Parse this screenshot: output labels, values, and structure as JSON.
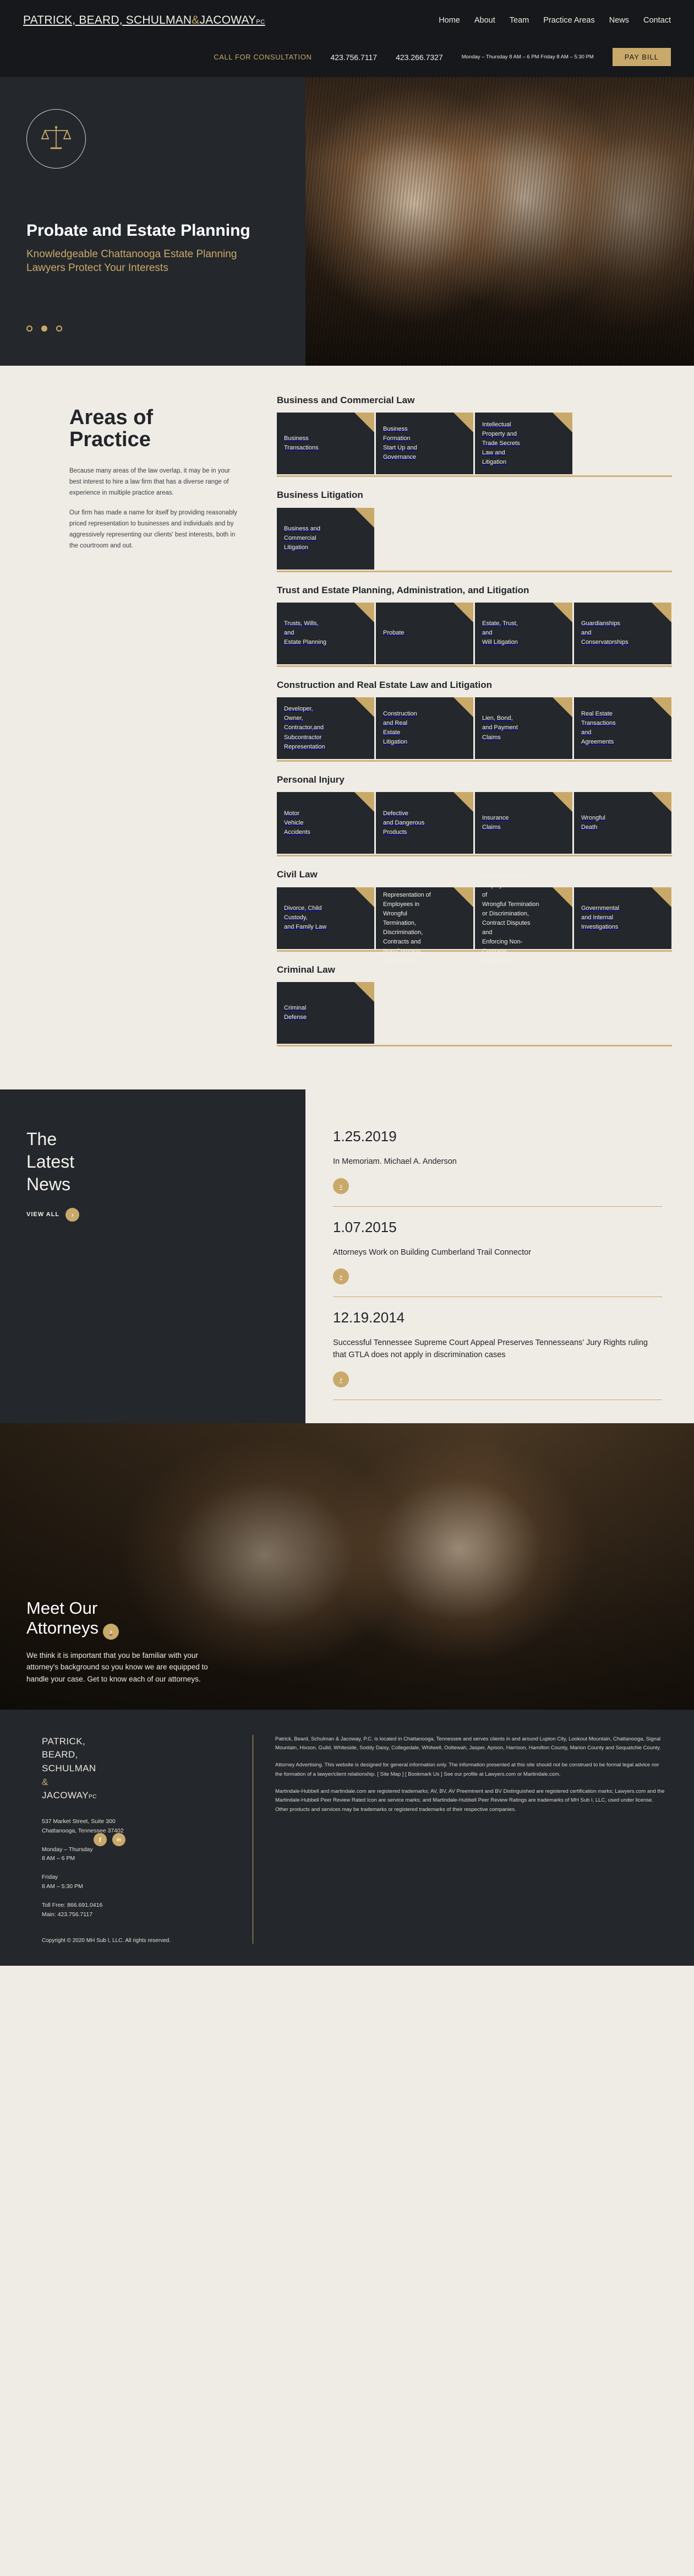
{
  "brand": {
    "name_line1": "PATRICK, BEARD, SCHULMAN",
    "amp": "&",
    "name_line2": "JACOWAY",
    "suffix": "PC",
    "accent_color": "#c9a96a",
    "dark_color": "#24272b",
    "page_bg": "#efece5"
  },
  "nav": {
    "items": [
      {
        "label": "Home"
      },
      {
        "label": "About"
      },
      {
        "label": "Team"
      },
      {
        "label": "Practice Areas"
      },
      {
        "label": "News"
      },
      {
        "label": "Contact"
      }
    ]
  },
  "contactbar": {
    "cta": "CALL FOR CONSULTATION",
    "phone1": "423.756.7117",
    "phone2": "423.266.7327",
    "hours": "Monday – Thursday\n8 AM – 6 PM\nFriday\n8 AM – 5:30 PM",
    "pay_bill": "PAY BILL"
  },
  "hero": {
    "icon": "scales-of-justice-icon",
    "title": "Probate and Estate Planning",
    "subtitle": "Knowledgeable Chattanooga Estate Planning\nLawyers Protect Your Interests",
    "slides": 3,
    "active_slide": 2
  },
  "practice": {
    "heading": "Areas of\nPractice",
    "paragraphs": [
      "Because many areas of the law overlap, it may be in your best interest to hire a law firm that has a diverse range of experience in multiple practice areas.",
      "Our firm has made a name for itself by providing reasonably priced representation to businesses and individuals and by aggressively representing our clients' best interests, both in the courtroom and out."
    ],
    "groups": [
      {
        "heading": "Business and Commercial Law",
        "cards": [
          {
            "label": "Business\nTransactions",
            "overflow": false
          },
          {
            "label": "Business\nFormation\nStart Up and\nGovernance",
            "overflow": false
          },
          {
            "label": "Intellectual\nProperty and\nTrade Secrets\nLaw and\nLitigation",
            "overflow": false
          }
        ]
      },
      {
        "heading": "Business Litigation",
        "cards": [
          {
            "label": "Business and\nCommercial\nLitigation",
            "overflow": false
          }
        ]
      },
      {
        "heading": "Trust and Estate Planning, Administration, and Litigation",
        "cards": [
          {
            "label": "Trusts, Wills,\nand\nEstate Planning",
            "overflow": false
          },
          {
            "label": "Probate",
            "overflow": false
          },
          {
            "label": "Estate, Trust,\nand\nWill Litigation",
            "overflow": false
          },
          {
            "label": "Guardianships\nand\nConservatorships",
            "overflow": false
          }
        ]
      },
      {
        "heading": "Construction and Real Estate Law and Litigation",
        "cards": [
          {
            "label": "Developer,\nOwner,\nContractor,and\nSubcontractor\nRepresentation",
            "overflow": false
          },
          {
            "label": "Construction\nand Real\nEstate\nLitigation",
            "overflow": false
          },
          {
            "label": "Lien, Bond,\nand Payment\nClaims",
            "overflow": false
          },
          {
            "label": "Real Estate\nTransactions\nand\nAgreements",
            "overflow": false
          }
        ]
      },
      {
        "heading": "Personal Injury",
        "cards": [
          {
            "label": "Motor\nVehicle\nAccidents",
            "overflow": false
          },
          {
            "label": "Defective\nand Dangerous\nProducts",
            "overflow": false
          },
          {
            "label": "Insurance\nClaims",
            "overflow": false
          },
          {
            "label": "Wrongful\nDeath",
            "overflow": false
          }
        ]
      },
      {
        "heading": "Civil Law",
        "cards": [
          {
            "label": "Divorce, Child\nCustody,\nand Family Law",
            "overflow": false
          },
          {
            "label": "Representation of\nEmployees in\nWrongful\nTermination,\nDiscrimination,\nContracts and\nNon-Compete\nAgreements",
            "overflow": true
          },
          {
            "label": "Representation of\nEmployers in Claims\nof\nWrongful Termination\nor Discrimination,\nContract Disputes\nand\nEnforcing Non-\nCompete\nAgreements",
            "overflow": true
          },
          {
            "label": "Governmental\nand Internal\nInvestigations",
            "overflow": false
          }
        ]
      },
      {
        "heading": "Criminal Law",
        "cards": [
          {
            "label": "Criminal\nDefense",
            "overflow": false
          }
        ]
      }
    ]
  },
  "news": {
    "heading": "The\nLatest\nNews",
    "view_all": "VIEW ALL",
    "items": [
      {
        "date": "1.25.2019",
        "title": "In Memoriam. Michael A. Anderson"
      },
      {
        "date": "1.07.2015",
        "title": "Attorneys Work on Building Cumberland Trail Connector"
      },
      {
        "date": "12.19.2014",
        "title": "Successful Tennessee Supreme Court Appeal Preserves Tennesseans’ Jury Rights ruling that GTLA does not apply in discrimination cases"
      }
    ]
  },
  "attorneys": {
    "heading": "Meet Our\nAttorneys",
    "body": "We think it is important that you be familiar with your attorney's background so you know we are equipped to handle your case. Get to know each of our attorneys."
  },
  "footer": {
    "logo_lines": [
      "PATRICK,",
      "BEARD,",
      "SCHULMAN"
    ],
    "logo_amp": "&",
    "logo_last": "JACOWAY",
    "logo_suffix": "PC",
    "address": "537 Market Street, Suite 300\nChattanooga, Tennessee 37402",
    "hours": "Monday – Thursday\n8 AM – 6 PM",
    "hours2": "Friday\n8 AM – 5:30 PM",
    "phones": "Toll Free: 866.691.0416\nMain: 423.756.7117",
    "copyright": "Copyright © 2020 MH Sub I, LLC. All rights reserved.",
    "legal": [
      "Patrick, Beard, Schulman & Jacoway, P.C. is located in Chattanooga, Tennessee and serves clients in and around Lupton City, Lookout Mountain, Chattanooga, Signal Mountain, Hixson, Guild, Whiteside, Soddy Daisy, Collegedale, Whitwell, Ooltewah, Jasper, Apison, Harrison, Hamilton County, Marion County and Sequatchie County.",
      "Attorney Advertising. This website is designed for general information only. The information presented at this site should not be construed to be formal legal advice nor the formation of a lawyer/client relationship. [ Site Map ] [ Bookmark Us ] See our profile at Lawyers.com or Martindale.com.",
      "Martindale-Hubbell and martindale.com are registered trademarks; AV, BV, AV Preeminent and BV Distinguished are registered certification marks; Lawyers.com and the Martindale-Hubbell Peer Review Rated Icon are service marks; and Martindale-Hubbell Peer Review Ratings are trademarks of MH Sub I, LLC, used under license. Other products and services may be trademarks or registered trademarks of their respective companies."
    ],
    "social": [
      {
        "name": "facebook",
        "glyph": "f"
      },
      {
        "name": "linkedin",
        "glyph": "in"
      }
    ]
  }
}
